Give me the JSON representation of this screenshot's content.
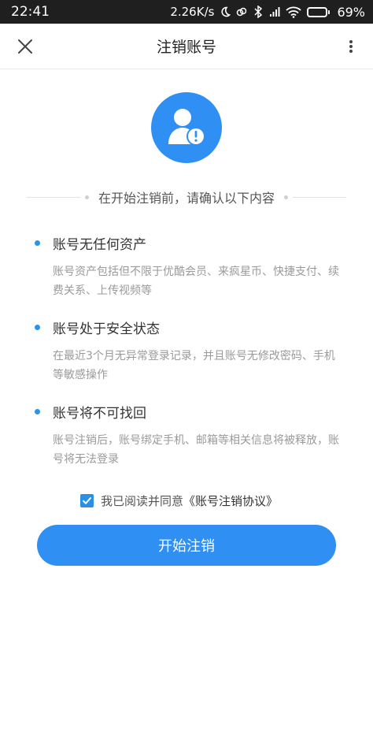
{
  "status_bar": {
    "time": "22:41",
    "network_speed": "2.26K/s",
    "battery_percent": "69%",
    "battery_level": 0.69
  },
  "nav": {
    "title": "注销账号"
  },
  "notice": {
    "heading": "在开始注销前，请确认以下内容"
  },
  "items": [
    {
      "title": "账号无任何资产",
      "desc": "账号资产包括但不限于优酷会员、来疯星币、快捷支付、续费关系、上传视频等"
    },
    {
      "title": "账号处于安全状态",
      "desc": "在最近3个月无异常登录记录，并且账号无修改密码、手机等敏感操作"
    },
    {
      "title": "账号将不可找回",
      "desc": "账号注销后，账号绑定手机、邮箱等相关信息将被释放，账号将无法登录"
    }
  ],
  "agreement": {
    "checked": true,
    "prefix": "我已阅读并同意",
    "link": "《账号注销协议》"
  },
  "primary_button": {
    "label": "开始注销"
  },
  "colors": {
    "accent": "#2f8ff2",
    "status_bar_bg": "#1f1f1f"
  }
}
